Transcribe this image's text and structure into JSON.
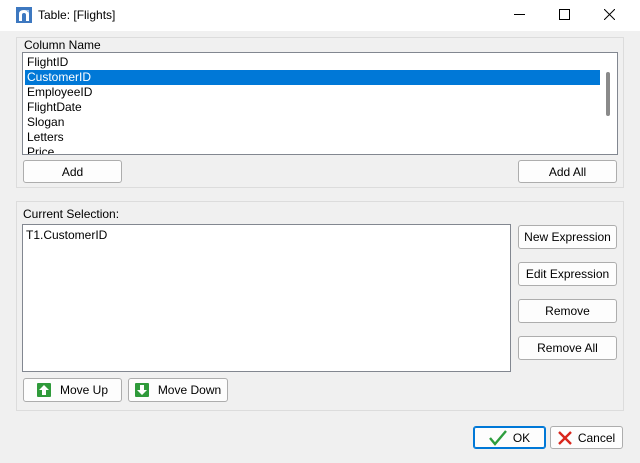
{
  "window": {
    "title": "Table: [Flights]"
  },
  "column_group": {
    "label": "Column Name",
    "items": [
      "FlightID",
      "CustomerID",
      "EmployeeID",
      "FlightDate",
      "Slogan",
      "Letters",
      "Price"
    ],
    "selected_item": "CustomerID",
    "add_label": "Add",
    "add_all_label": "Add All"
  },
  "selection_group": {
    "label": "Current Selection:",
    "items": [
      "T1.CustomerID"
    ],
    "new_expression_label": "New Expression",
    "edit_expression_label": "Edit Expression",
    "remove_label": "Remove",
    "remove_all_label": "Remove All",
    "move_up_label": "Move Up",
    "move_down_label": "Move Down"
  },
  "footer": {
    "ok_label": "OK",
    "cancel_label": "Cancel"
  },
  "colors": {
    "selection": "#0078d7",
    "ok_check": "#2e9e3e",
    "cancel_x": "#d9261c",
    "arrow_green": "#2f9a3a"
  },
  "icons": {
    "app": "table-app-icon",
    "minimize": "minimize-icon",
    "maximize": "maximize-icon",
    "close": "close-icon",
    "move_up": "arrow-up-icon",
    "move_down": "arrow-down-icon",
    "ok": "checkmark-icon",
    "cancel": "x-icon"
  }
}
